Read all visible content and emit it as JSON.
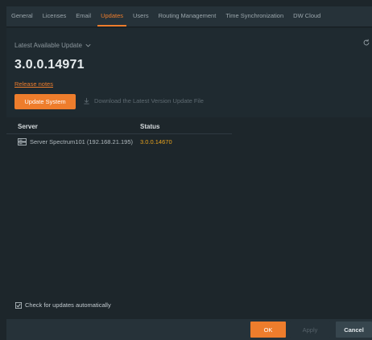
{
  "tabs": [
    {
      "label": "General",
      "active": false
    },
    {
      "label": "Licenses",
      "active": false
    },
    {
      "label": "Email",
      "active": false
    },
    {
      "label": "Updates",
      "active": true
    },
    {
      "label": "Users",
      "active": false
    },
    {
      "label": "Routing Management",
      "active": false
    },
    {
      "label": "Time Synchronization",
      "active": false
    },
    {
      "label": "DW Cloud",
      "active": false
    }
  ],
  "header": {
    "latest_label": "Latest Available Update",
    "version": "3.0.0.14971",
    "release_notes": "Release notes",
    "update_button": "Update System",
    "download_link": "Download the Latest Version Update File",
    "icons": {
      "dropdown": "chevron-down-icon",
      "refresh": "refresh-icon",
      "download": "download-icon"
    }
  },
  "table": {
    "columns": [
      "Server",
      "Status"
    ],
    "rows": [
      {
        "server": "Server Spectrum101 (192.168.21.195)",
        "status": "3.0.0.14670",
        "icon": "server-icon"
      }
    ]
  },
  "auto_check": {
    "label": "Check for updates automatically",
    "checked": true
  },
  "footer": {
    "ok": "OK",
    "apply": "Apply",
    "cancel": "Cancel"
  },
  "colors": {
    "accent": "#ee7d2c",
    "status_version": "#e6a21d",
    "background": "#1d262b",
    "panel": "#263239"
  }
}
